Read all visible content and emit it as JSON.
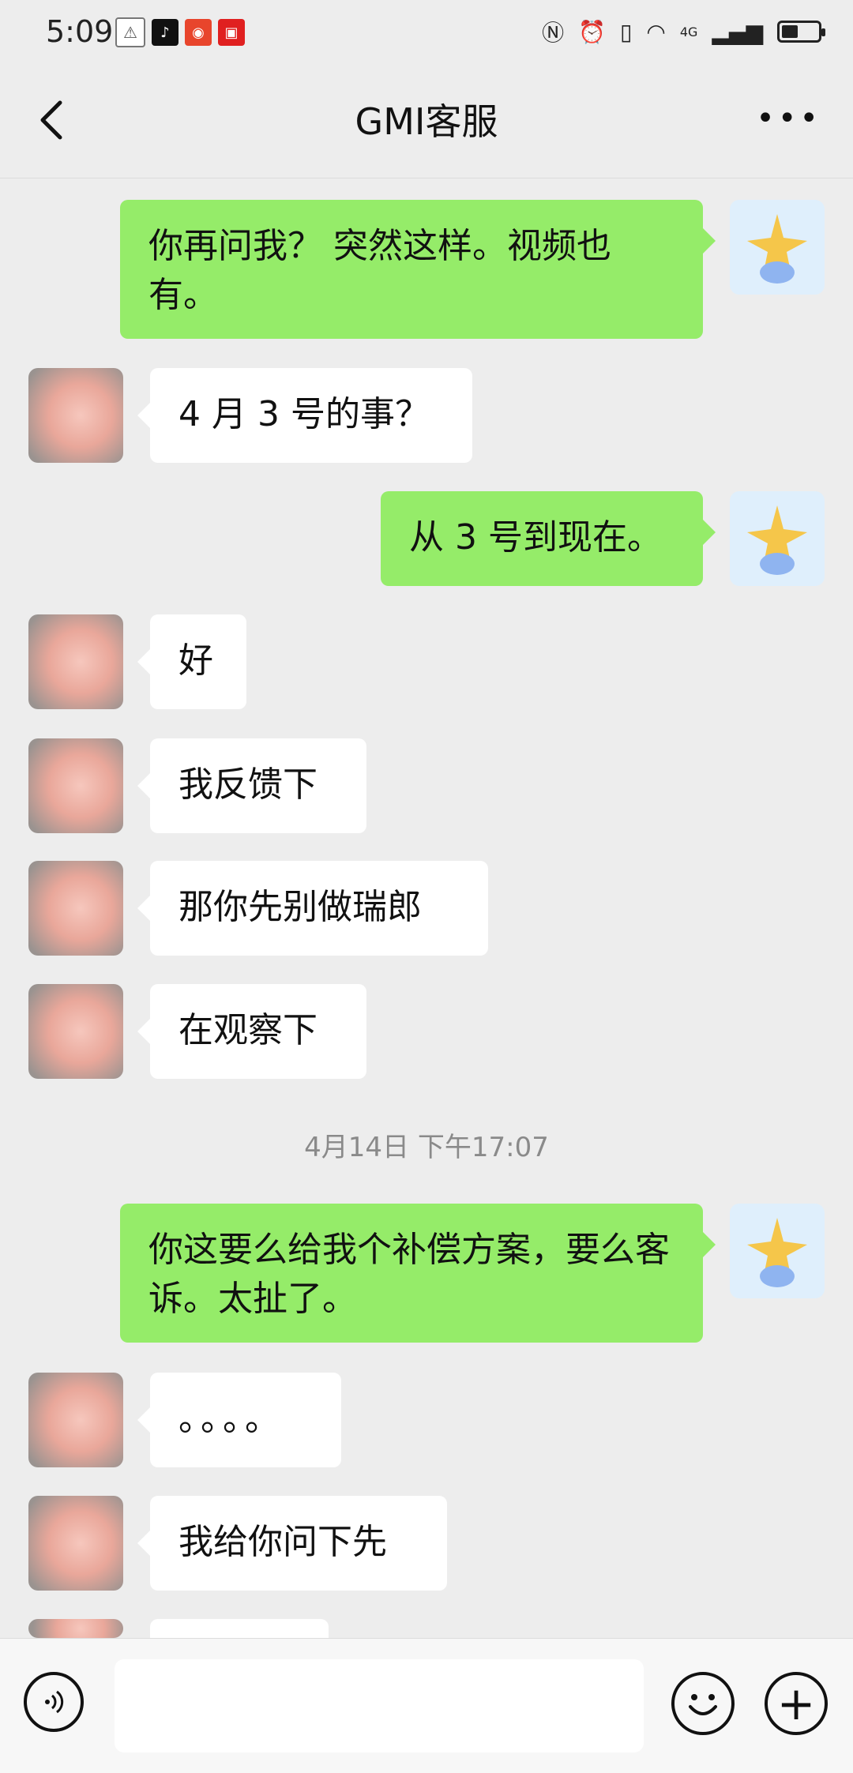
{
  "status_bar": {
    "time": "5:09",
    "network": "4G"
  },
  "header": {
    "title": "GMI客服"
  },
  "messages": [
    {
      "text": "你再问我？ 突然这样。视频也有。",
      "sender": "me"
    },
    {
      "text": "4 月 3 号的事？",
      "sender": "them"
    },
    {
      "text": "从 3 号到现在。",
      "sender": "me"
    },
    {
      "text": "好",
      "sender": "them"
    },
    {
      "text": "我反馈下",
      "sender": "them"
    },
    {
      "text": "那你先别做瑞郎",
      "sender": "them"
    },
    {
      "text": "在观察下",
      "sender": "them"
    },
    {
      "text": "你这要么给我个补偿方案，要么客诉。太扯了。",
      "sender": "me"
    },
    {
      "text": "。。。。",
      "sender": "them"
    },
    {
      "text": "我给你问下先",
      "sender": "them"
    }
  ],
  "timestamp": "4月14日 下午17:07",
  "colors": {
    "my_bubble": "#95ec69",
    "their_bubble": "#ffffff",
    "background": "#ededed"
  }
}
